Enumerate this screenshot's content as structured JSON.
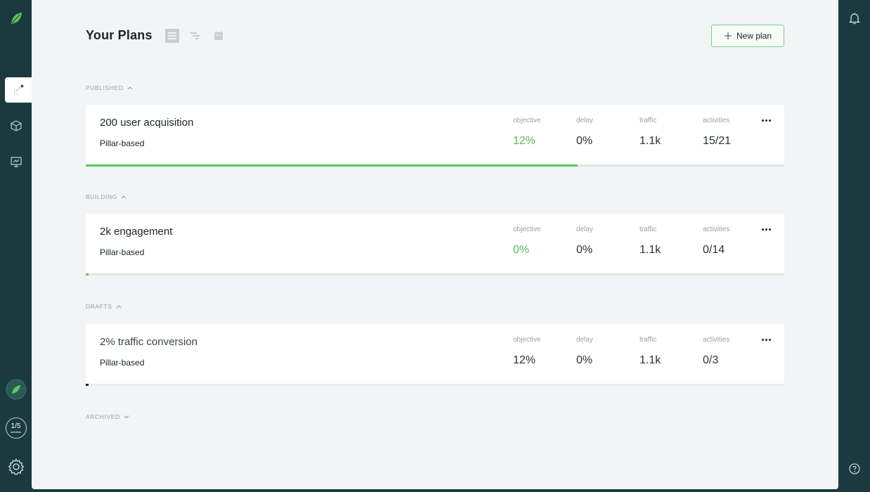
{
  "header": {
    "title": "Your Plans",
    "new_plan_label": "New plan"
  },
  "sidebar": {
    "activities_badge": "1/5",
    "activities_sub": "activities"
  },
  "sections": {
    "published": "PUBLISHED",
    "building": "BUILDING",
    "drafts": "DRAFTS",
    "archived": "ARCHIVED"
  },
  "labels": {
    "objective": "objective",
    "delay": "delay",
    "traffic": "traffic",
    "activities": "activities"
  },
  "plans": [
    {
      "title": "200 user acquisition",
      "type": "Pillar-based",
      "objective": "12%",
      "delay": "0%",
      "traffic": "1.1k",
      "activities": "15/21",
      "progress": 0.704,
      "progress_color": "#5cc85c"
    },
    {
      "title": "2k engagement",
      "type": "Pillar-based",
      "objective": "0%",
      "delay": "0%",
      "traffic": "1.1k",
      "activities": "0/14",
      "progress": 0.004,
      "progress_color": "#5cc85c"
    },
    {
      "title": "2% traffic conversion",
      "type": "Pillar-based",
      "objective": "12%",
      "delay": "0%",
      "traffic": "1.1k",
      "activities": "0/3",
      "progress": 0.004,
      "progress_color": "#1c2426"
    }
  ],
  "colors": {
    "accent": "#5cb85c",
    "sidebar": "#1a3a3f"
  }
}
